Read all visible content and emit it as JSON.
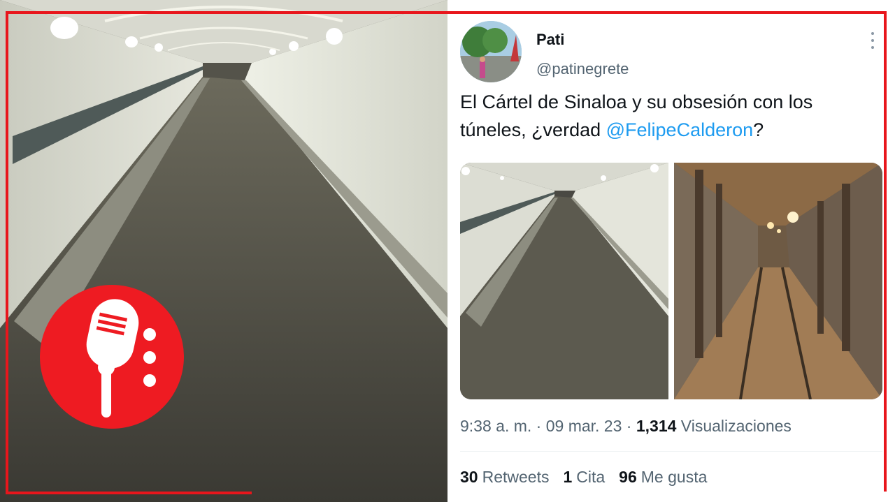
{
  "tweet": {
    "display_name": "Pati",
    "handle": "@patinegrete",
    "text_before": "El Cártel de Sinaloa y su obsesión con los túneles, ¿verdad ",
    "mention": "@FelipeCalderon",
    "text_after": "?",
    "time": "9:38 a. m. · 09 mar. 23 · ",
    "views_count": "1,314",
    "views_label": " Visualizaciones",
    "retweets_count": "30",
    "retweets_label": "Retweets",
    "quotes_count": "1",
    "quotes_label": "Cita",
    "likes_count": "96",
    "likes_label": "Me gusta"
  },
  "icons": {
    "logo": "microphone-icon",
    "menu": "more-options-icon"
  },
  "colors": {
    "accent_red": "#e8161c",
    "mention_blue": "#1d9bf0"
  }
}
